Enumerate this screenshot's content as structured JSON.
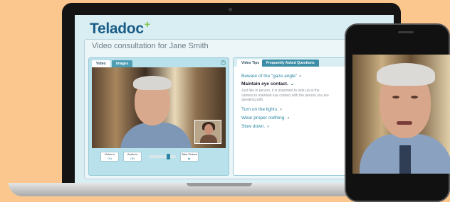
{
  "app": {
    "brand": "Teladoc",
    "brand_mark": "+",
    "consult_title": "Video consultation for Jane Smith"
  },
  "video_panel": {
    "tabs": [
      {
        "label": "Video",
        "active": true
      },
      {
        "label": "Images",
        "active": false
      }
    ],
    "controls": [
      {
        "label": "Video is",
        "state": "ON"
      },
      {
        "label": "Audio is",
        "state": "ON"
      },
      {
        "label": "Take Picture",
        "state": "▶"
      }
    ]
  },
  "tips_panel": {
    "tabs": [
      {
        "label": "Video Tips",
        "active": true
      },
      {
        "label": "Frequently Asked Questions",
        "active": false
      }
    ],
    "items": [
      {
        "label": "Beware of the \"gaze angle\"",
        "expanded": false
      },
      {
        "label": "Maintain eye contact.",
        "expanded": true,
        "body": "Just like in person, it is important to look up at the camera to maintain eye contact with the person you are speaking with."
      },
      {
        "label": "Turn on the lights.",
        "expanded": false
      },
      {
        "label": "Wear proper clothing.",
        "expanded": false
      },
      {
        "label": "Slow down.",
        "expanded": false
      }
    ]
  },
  "colors": {
    "background": "#fbc78f",
    "brand": "#1a5d86",
    "accent": "#2b86a3",
    "brand_plus": "#7cc243"
  }
}
